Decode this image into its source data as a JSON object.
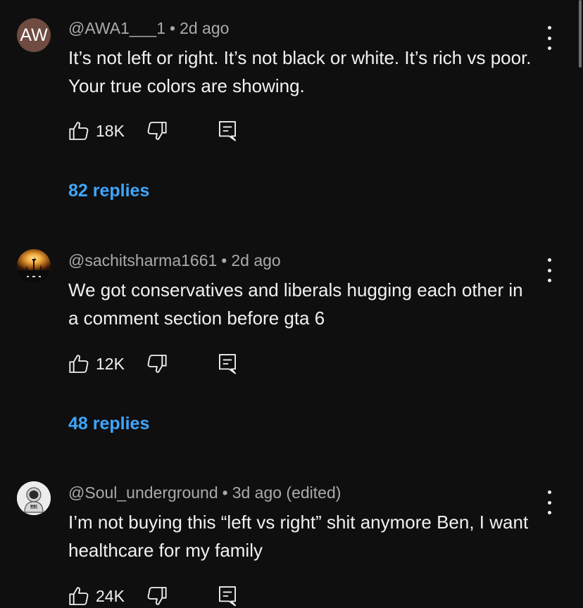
{
  "comments": [
    {
      "avatar_initials": "AW",
      "avatar_color": "#6f4b40",
      "handle": "@AWA1___1",
      "time": "2d ago",
      "text": "It’s not left or right. It’s not black or white. It’s rich vs poor. Your true colors are showing.",
      "likes": "18K",
      "replies_label": "82 replies"
    },
    {
      "avatar_image": "sunset-silhouette",
      "handle": "@sachitsharma1661",
      "time": "2d ago",
      "text": "We got conservatives and liberals hugging each other in a comment section before gta 6",
      "likes": "12K",
      "replies_label": "48 replies"
    },
    {
      "avatar_image": "astronaut",
      "handle": "@Soul_underground",
      "time": "3d ago (edited)",
      "text": "I’m not buying this “left vs right” shit anymore Ben, I want healthcare for my family",
      "likes": "24K"
    }
  ],
  "separator": "•",
  "icons": {
    "like": "thumbs-up-icon",
    "dislike": "thumbs-down-icon",
    "reply": "reply-icon",
    "menu": "more-vertical-icon"
  },
  "colors": {
    "background": "#0f0f0f",
    "text": "#f1f1f1",
    "meta": "#aaaaaa",
    "replies": "#3ea6ff"
  }
}
